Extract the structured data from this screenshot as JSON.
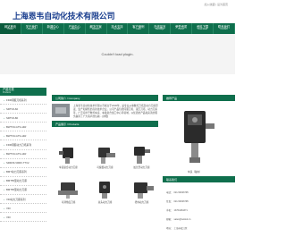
{
  "header": {
    "logo_text": "上海恩韦自动化技术有限公司",
    "topright": "加入收藏 | 设为首页"
  },
  "nav": [
    {
      "cn": "网站首页",
      "en": "Home",
      "active": true
    },
    {
      "cn": "关于我们",
      "en": "About Us"
    },
    {
      "cn": "新闻中心",
      "en": "News"
    },
    {
      "cn": "产品中心",
      "en": "Products"
    },
    {
      "cn": "解决方案",
      "en": "Solution"
    },
    {
      "cn": "技术支持",
      "en": "Service"
    },
    {
      "cn": "客户案例",
      "en": "Case"
    },
    {
      "cn": "在线留言",
      "en": "Message"
    },
    {
      "cn": "荣誉资质",
      "en": "Honor"
    },
    {
      "cn": "资料下载",
      "en": "Download"
    },
    {
      "cn": "联系我们",
      "en": "Contact"
    }
  ],
  "banner": {
    "text": "Couldn't load plugin."
  },
  "sidebar": {
    "title_cn": "产品分类",
    "title_en": "Products",
    "items": [
      "FDR伺服刀塔系列",
      "SRTV9-60",
      "SRTV9-80",
      "BWTV9-GTS-14R",
      "BWTV9-GTS-14R",
      "FDR伺服动力刀塔系列",
      "BWTV9-GTS-14R",
      "SRRV9-VRRV-TTV2",
      "BMT动力刀座系列",
      "BMT55型动力刀座",
      "BMT65型动力刀座",
      "VDI动力刀座系列",
      "VDI",
      "VDI"
    ]
  },
  "intro": {
    "title": "公司简介 / Company",
    "text": "上海恩韦自动化技术有限公司成立于2006年，是专业从事数控刀塔及动力刀座研发、生产和销售的高新技术企业。公司产品包括伺服刀塔、液压刀塔、动力刀座等，广泛应用于数控车床、车铣复合加工中心等领域，以优质的产品和完善的服务赢得了广大客户的信赖…[详细]"
  },
  "products": {
    "title": "产品展示 / Products",
    "items": [
      {
        "name": "车铣复合动力刀座"
      },
      {
        "name": "可偏置动力刀座"
      },
      {
        "name": "加长型动力刀座"
      },
      {
        "name": "可调角度刀座"
      },
      {
        "name": "双头动力刀座"
      },
      {
        "name": "径向动力刀座"
      }
    ]
  },
  "right": {
    "title": "推荐产品",
    "caption": "车铣（轴向）"
  },
  "contact": {
    "title": "联系我们",
    "lines": [
      {
        "label": "电话：",
        "value": "021-54826795"
      },
      {
        "label": "传真：",
        "value": "021-54826795"
      },
      {
        "label": "手机：",
        "value": "13764264371"
      },
      {
        "label": "邮箱：",
        "value": "sales@nwtool.cn"
      },
      {
        "label": "地址：",
        "value": "上海市松江区"
      }
    ]
  },
  "colors": {
    "primary": "#0f6f4d",
    "logo": "#1b3f8f"
  }
}
